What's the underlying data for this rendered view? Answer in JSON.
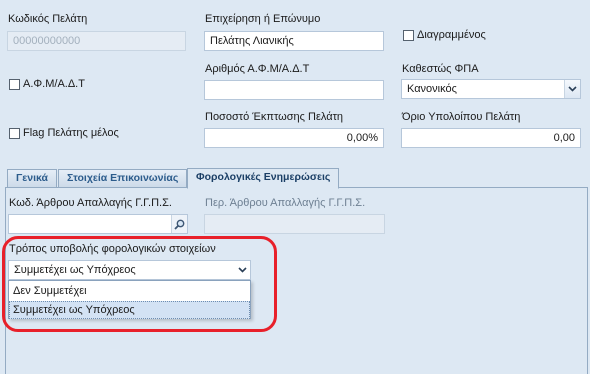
{
  "customer_code": {
    "label": "Κωδικός Πελάτη",
    "value": "00000000000"
  },
  "company_name": {
    "label": "Επιχείρηση ή Επώνυμο",
    "value": "Πελάτης Λιανικής"
  },
  "deleted": {
    "label": "Διαγραμμένος",
    "checked": false
  },
  "afm_checkbox": {
    "label": "Α.Φ.Μ/Α.Δ.Τ",
    "checked": false
  },
  "afm_field": {
    "label": "Αριθμός Α.Φ.Μ/Α.Δ.Τ",
    "value": ""
  },
  "vat_status": {
    "label": "Καθεστώς ΦΠΑ",
    "value": "Κανονικός"
  },
  "member_flag": {
    "label": "Flag Πελάτης μέλος",
    "checked": false
  },
  "discount": {
    "label": "Ποσοστό Έκπτωσης Πελάτη",
    "value": "0,00%"
  },
  "balance_limit": {
    "label": "Όριο Υπολοίπου Πελάτη",
    "value": "0,00"
  },
  "tabs": [
    {
      "label": "Γενικά",
      "active": false
    },
    {
      "label": "Στοιχεία Επικοινωνίας",
      "active": false
    },
    {
      "label": "Φορολογικές Ενημερώσεις",
      "active": true
    }
  ],
  "exemption_code": {
    "label": "Κωδ. Άρθρου Απαλλαγής Γ.Γ.Π.Σ.",
    "value": ""
  },
  "exemption_desc": {
    "label": "Περ. Άρθρου Απαλλαγής Γ.Γ.Π.Σ.",
    "value": ""
  },
  "tax_submission": {
    "label": "Τρόπος υποβολής φορολογικών στοιχείων",
    "selected": "Συμμετέχει ως Υπόχρεος",
    "options": [
      "Δεν Συμμετέχει",
      "Συμμετέχει ως Υπόχρεος"
    ],
    "hovered_index": 1
  },
  "colors": {
    "highlight": "#e8202a",
    "panel": "#dde8f3",
    "tab_text": "#2c5c8c"
  },
  "icons": {
    "lookup": "magnifier-icon",
    "combo": "chevron-down-icon"
  }
}
